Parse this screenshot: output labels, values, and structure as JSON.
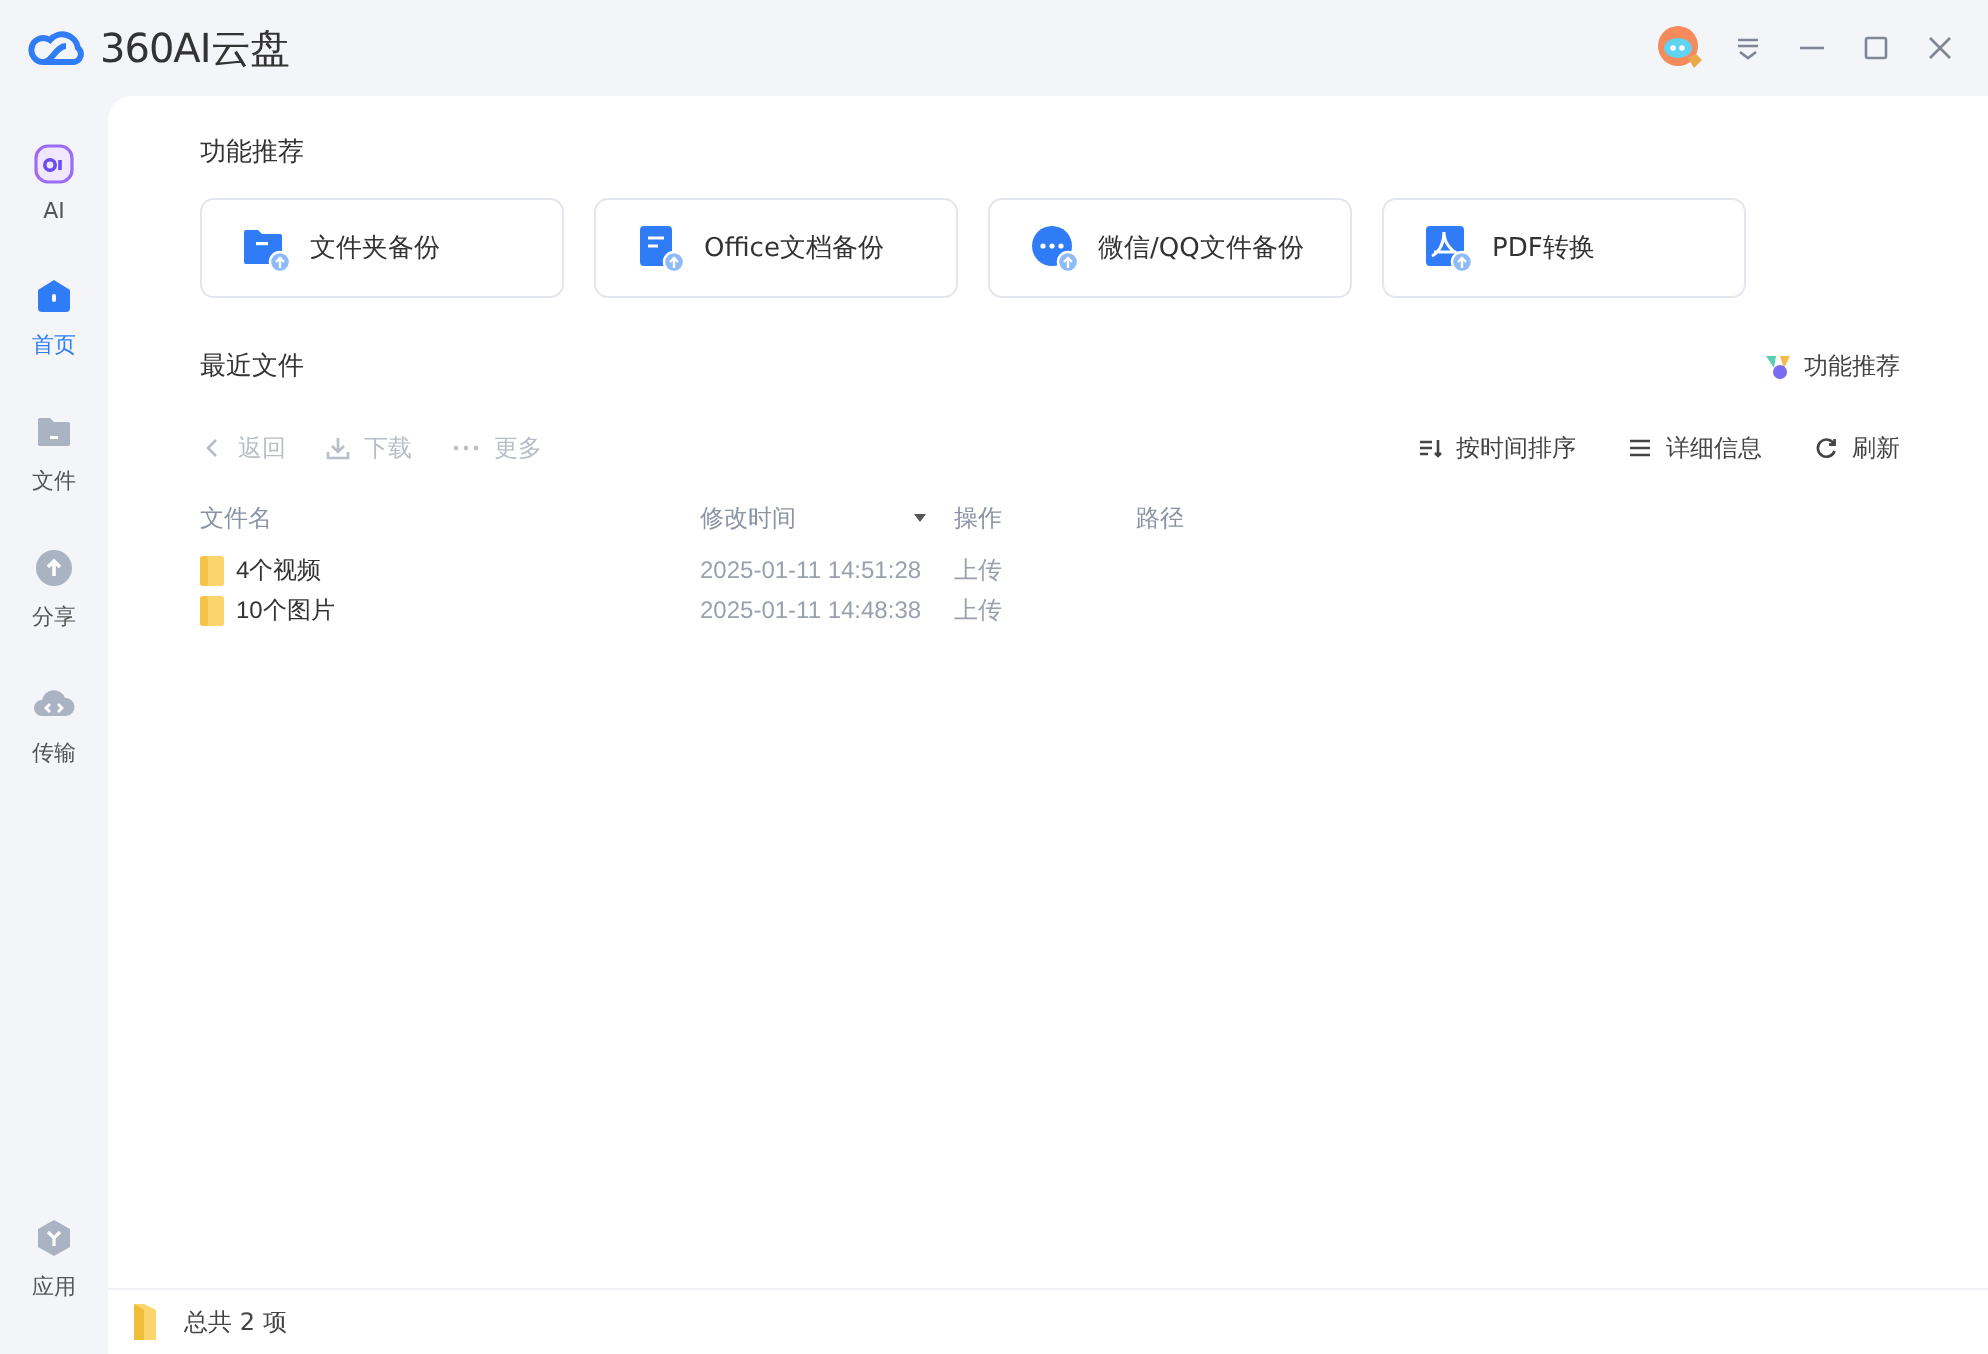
{
  "app": {
    "title": "360AI云盘"
  },
  "sidebar": {
    "items": [
      {
        "kind": "ai",
        "label": "AI",
        "selected": false
      },
      {
        "kind": "home",
        "label": "首页",
        "selected": true
      },
      {
        "kind": "file",
        "label": "文件",
        "selected": false
      },
      {
        "kind": "share",
        "label": "分享",
        "selected": false
      },
      {
        "kind": "transfer",
        "label": "传输",
        "selected": false
      }
    ],
    "bottom": {
      "kind": "apps",
      "label": "应用",
      "selected": false
    }
  },
  "features": {
    "title": "功能推荐",
    "cards": [
      {
        "kind": "folder",
        "label": "文件夹备份"
      },
      {
        "kind": "doc",
        "label": "Office文档备份"
      },
      {
        "kind": "chat",
        "label": "微信/QQ文件备份"
      },
      {
        "kind": "pdf",
        "label": "PDF转换"
      }
    ]
  },
  "recent": {
    "title": "最近文件",
    "link": "功能推荐"
  },
  "toolbar": {
    "left": [
      {
        "kind": "back",
        "label": "返回",
        "disabled": true
      },
      {
        "kind": "download",
        "label": "下载",
        "disabled": true
      },
      {
        "kind": "more",
        "label": "更多",
        "disabled": true
      }
    ],
    "right": [
      {
        "kind": "sort",
        "label": "按时间排序"
      },
      {
        "kind": "details",
        "label": "详细信息"
      },
      {
        "kind": "refresh",
        "label": "刷新"
      }
    ]
  },
  "table": {
    "columns": [
      {
        "label": "文件名",
        "sorted": false
      },
      {
        "label": "修改时间",
        "sorted": true
      },
      {
        "label": "操作",
        "sorted": false
      },
      {
        "label": "路径",
        "sorted": false
      }
    ],
    "rows": [
      {
        "name": "4个视频",
        "modified": "2025-01-11 14:51:28",
        "action": "上传"
      },
      {
        "name": "10个图片",
        "modified": "2025-01-11 14:48:38",
        "action": "上传"
      }
    ]
  },
  "status_bar": {
    "text": "总共 2 项"
  }
}
